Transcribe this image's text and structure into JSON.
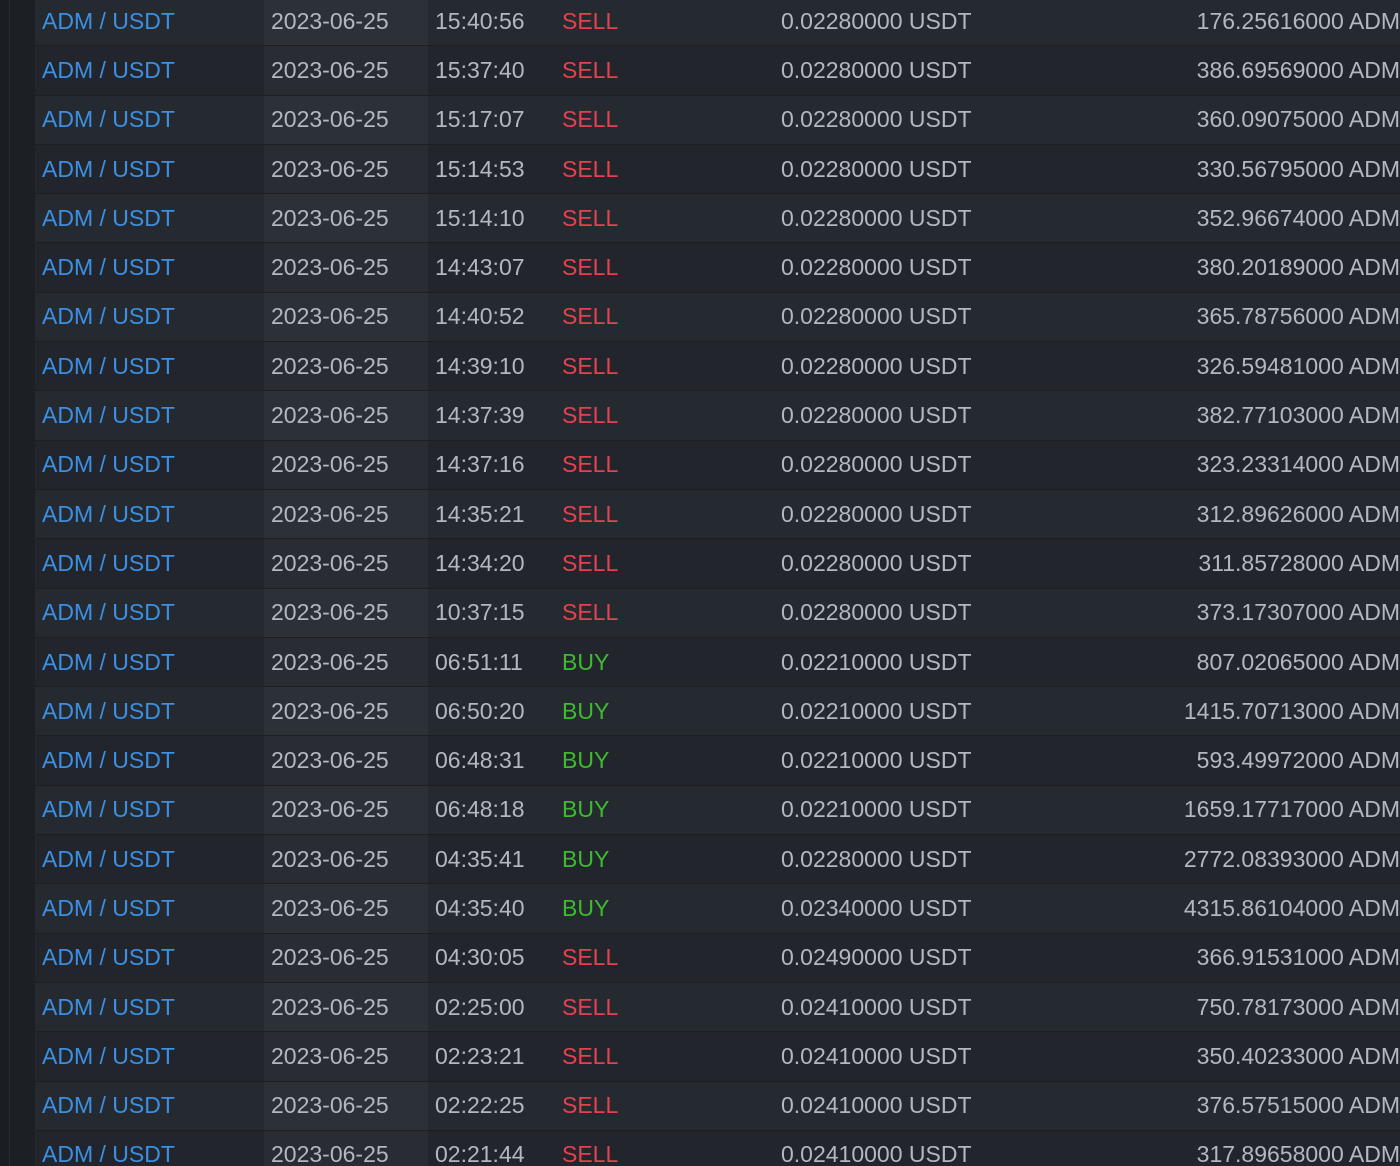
{
  "colors": {
    "background": "#1c1f23",
    "pair_link": "#3c8fe3",
    "sell": "#e5414f",
    "buy": "#3dbb2e",
    "text": "#b3b8bf"
  },
  "trades": [
    {
      "pair": "ADM / USDT",
      "date": "2023-06-25",
      "time": "15:40:56",
      "side": "SELL",
      "price": "0.02280000 USDT",
      "amount": "176.25616000 ADM"
    },
    {
      "pair": "ADM / USDT",
      "date": "2023-06-25",
      "time": "15:37:40",
      "side": "SELL",
      "price": "0.02280000 USDT",
      "amount": "386.69569000 ADM"
    },
    {
      "pair": "ADM / USDT",
      "date": "2023-06-25",
      "time": "15:17:07",
      "side": "SELL",
      "price": "0.02280000 USDT",
      "amount": "360.09075000 ADM"
    },
    {
      "pair": "ADM / USDT",
      "date": "2023-06-25",
      "time": "15:14:53",
      "side": "SELL",
      "price": "0.02280000 USDT",
      "amount": "330.56795000 ADM"
    },
    {
      "pair": "ADM / USDT",
      "date": "2023-06-25",
      "time": "15:14:10",
      "side": "SELL",
      "price": "0.02280000 USDT",
      "amount": "352.96674000 ADM"
    },
    {
      "pair": "ADM / USDT",
      "date": "2023-06-25",
      "time": "14:43:07",
      "side": "SELL",
      "price": "0.02280000 USDT",
      "amount": "380.20189000 ADM"
    },
    {
      "pair": "ADM / USDT",
      "date": "2023-06-25",
      "time": "14:40:52",
      "side": "SELL",
      "price": "0.02280000 USDT",
      "amount": "365.78756000 ADM"
    },
    {
      "pair": "ADM / USDT",
      "date": "2023-06-25",
      "time": "14:39:10",
      "side": "SELL",
      "price": "0.02280000 USDT",
      "amount": "326.59481000 ADM"
    },
    {
      "pair": "ADM / USDT",
      "date": "2023-06-25",
      "time": "14:37:39",
      "side": "SELL",
      "price": "0.02280000 USDT",
      "amount": "382.77103000 ADM"
    },
    {
      "pair": "ADM / USDT",
      "date": "2023-06-25",
      "time": "14:37:16",
      "side": "SELL",
      "price": "0.02280000 USDT",
      "amount": "323.23314000 ADM"
    },
    {
      "pair": "ADM / USDT",
      "date": "2023-06-25",
      "time": "14:35:21",
      "side": "SELL",
      "price": "0.02280000 USDT",
      "amount": "312.89626000 ADM"
    },
    {
      "pair": "ADM / USDT",
      "date": "2023-06-25",
      "time": "14:34:20",
      "side": "SELL",
      "price": "0.02280000 USDT",
      "amount": "311.85728000 ADM"
    },
    {
      "pair": "ADM / USDT",
      "date": "2023-06-25",
      "time": "10:37:15",
      "side": "SELL",
      "price": "0.02280000 USDT",
      "amount": "373.17307000 ADM"
    },
    {
      "pair": "ADM / USDT",
      "date": "2023-06-25",
      "time": "06:51:11",
      "side": "BUY",
      "price": "0.02210000 USDT",
      "amount": "807.02065000 ADM"
    },
    {
      "pair": "ADM / USDT",
      "date": "2023-06-25",
      "time": "06:50:20",
      "side": "BUY",
      "price": "0.02210000 USDT",
      "amount": "1415.70713000 ADM"
    },
    {
      "pair": "ADM / USDT",
      "date": "2023-06-25",
      "time": "06:48:31",
      "side": "BUY",
      "price": "0.02210000 USDT",
      "amount": "593.49972000 ADM"
    },
    {
      "pair": "ADM / USDT",
      "date": "2023-06-25",
      "time": "06:48:18",
      "side": "BUY",
      "price": "0.02210000 USDT",
      "amount": "1659.17717000 ADM"
    },
    {
      "pair": "ADM / USDT",
      "date": "2023-06-25",
      "time": "04:35:41",
      "side": "BUY",
      "price": "0.02280000 USDT",
      "amount": "2772.08393000 ADM"
    },
    {
      "pair": "ADM / USDT",
      "date": "2023-06-25",
      "time": "04:35:40",
      "side": "BUY",
      "price": "0.02340000 USDT",
      "amount": "4315.86104000 ADM"
    },
    {
      "pair": "ADM / USDT",
      "date": "2023-06-25",
      "time": "04:30:05",
      "side": "SELL",
      "price": "0.02490000 USDT",
      "amount": "366.91531000 ADM"
    },
    {
      "pair": "ADM / USDT",
      "date": "2023-06-25",
      "time": "02:25:00",
      "side": "SELL",
      "price": "0.02410000 USDT",
      "amount": "750.78173000 ADM"
    },
    {
      "pair": "ADM / USDT",
      "date": "2023-06-25",
      "time": "02:23:21",
      "side": "SELL",
      "price": "0.02410000 USDT",
      "amount": "350.40233000 ADM"
    },
    {
      "pair": "ADM / USDT",
      "date": "2023-06-25",
      "time": "02:22:25",
      "side": "SELL",
      "price": "0.02410000 USDT",
      "amount": "376.57515000 ADM"
    },
    {
      "pair": "ADM / USDT",
      "date": "2023-06-25",
      "time": "02:21:44",
      "side": "SELL",
      "price": "0.02410000 USDT",
      "amount": "317.89658000 ADM"
    }
  ]
}
